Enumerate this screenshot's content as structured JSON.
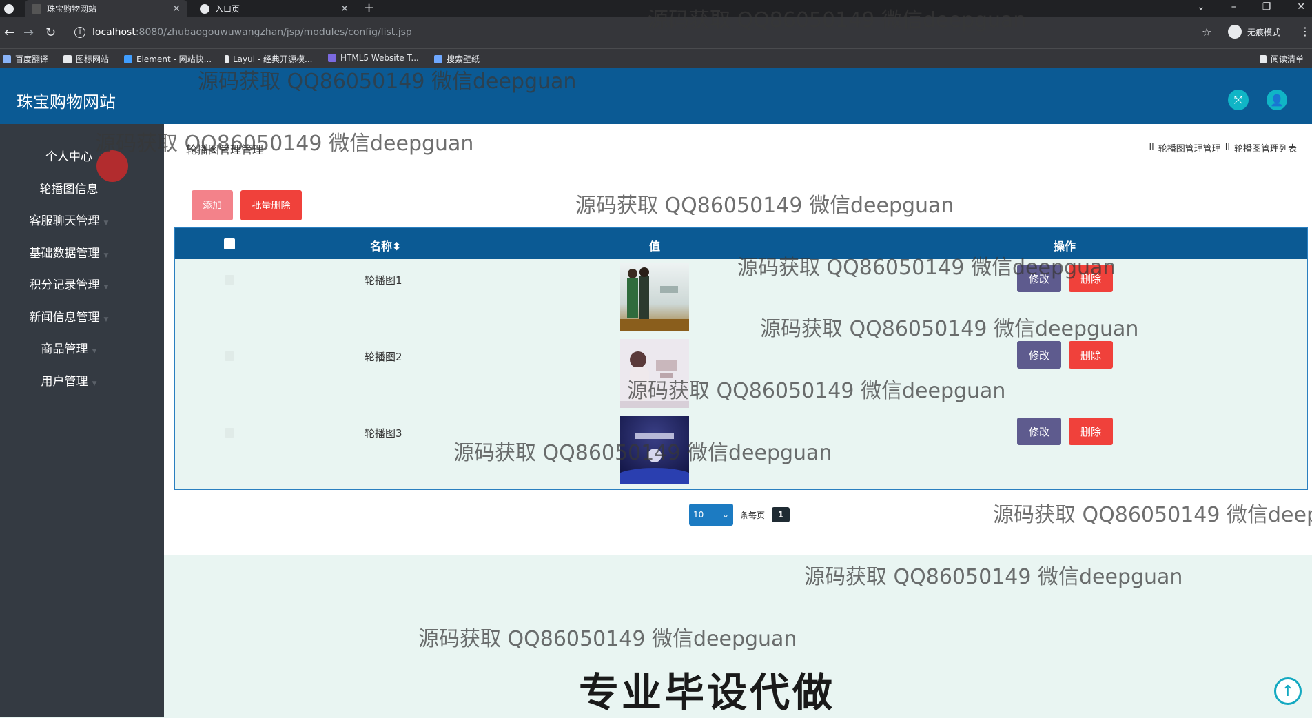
{
  "browser": {
    "tabs": [
      {
        "label": "珠宝购物网站",
        "active": true
      },
      {
        "label": "入口页",
        "active": false
      }
    ],
    "url_host": "localhost",
    "url_path": ":8080/zhubaogouwuwangzhan/jsp/modules/config/list.jsp",
    "profile_label": "无痕模式",
    "bookmarks": [
      "百度翻译",
      "图标网站",
      "Element - 网站快...",
      "Layui - 经典开源模...",
      "HTML5 Website T...",
      "搜索壁纸"
    ],
    "reading_list": "阅读清单"
  },
  "app": {
    "title": "珠宝购物网站",
    "accent_color": "#0b5a94",
    "header_icons": [
      "fullscreen-icon",
      "user-icon"
    ]
  },
  "sidebar": {
    "items": [
      {
        "label": "个人中心"
      },
      {
        "label": "轮播图信息"
      },
      {
        "label": "客服聊天管理"
      },
      {
        "label": "基础数据管理"
      },
      {
        "label": "积分记录管理"
      },
      {
        "label": "新闻信息管理"
      },
      {
        "label": "商品管理"
      },
      {
        "label": "用户管理"
      }
    ]
  },
  "main": {
    "page_title": "轮播图管理管理",
    "breadcrumb": [
      "轮播图管理管理",
      "轮播图管理列表"
    ],
    "breadcrumb_sep": "ll",
    "add_label": "添加",
    "batch_delete_label": "批量删除",
    "table": {
      "columns": [
        "名称",
        "值",
        "操作"
      ],
      "rows": [
        {
          "name": "轮播图1",
          "edit": "修改",
          "delete": "删除"
        },
        {
          "name": "轮播图2",
          "edit": "修改",
          "delete": "删除"
        },
        {
          "name": "轮播图3",
          "edit": "修改",
          "delete": "删除"
        }
      ]
    },
    "pager": {
      "page_size": "10",
      "per_page_label": "条每页",
      "current_page": "1"
    }
  },
  "watermark_text": "源码获取 QQ86050149 微信deepguan",
  "watermark_text_clipped": "源码获取 QQ86050149 微信deep",
  "banner_text": "专业毕设代做"
}
